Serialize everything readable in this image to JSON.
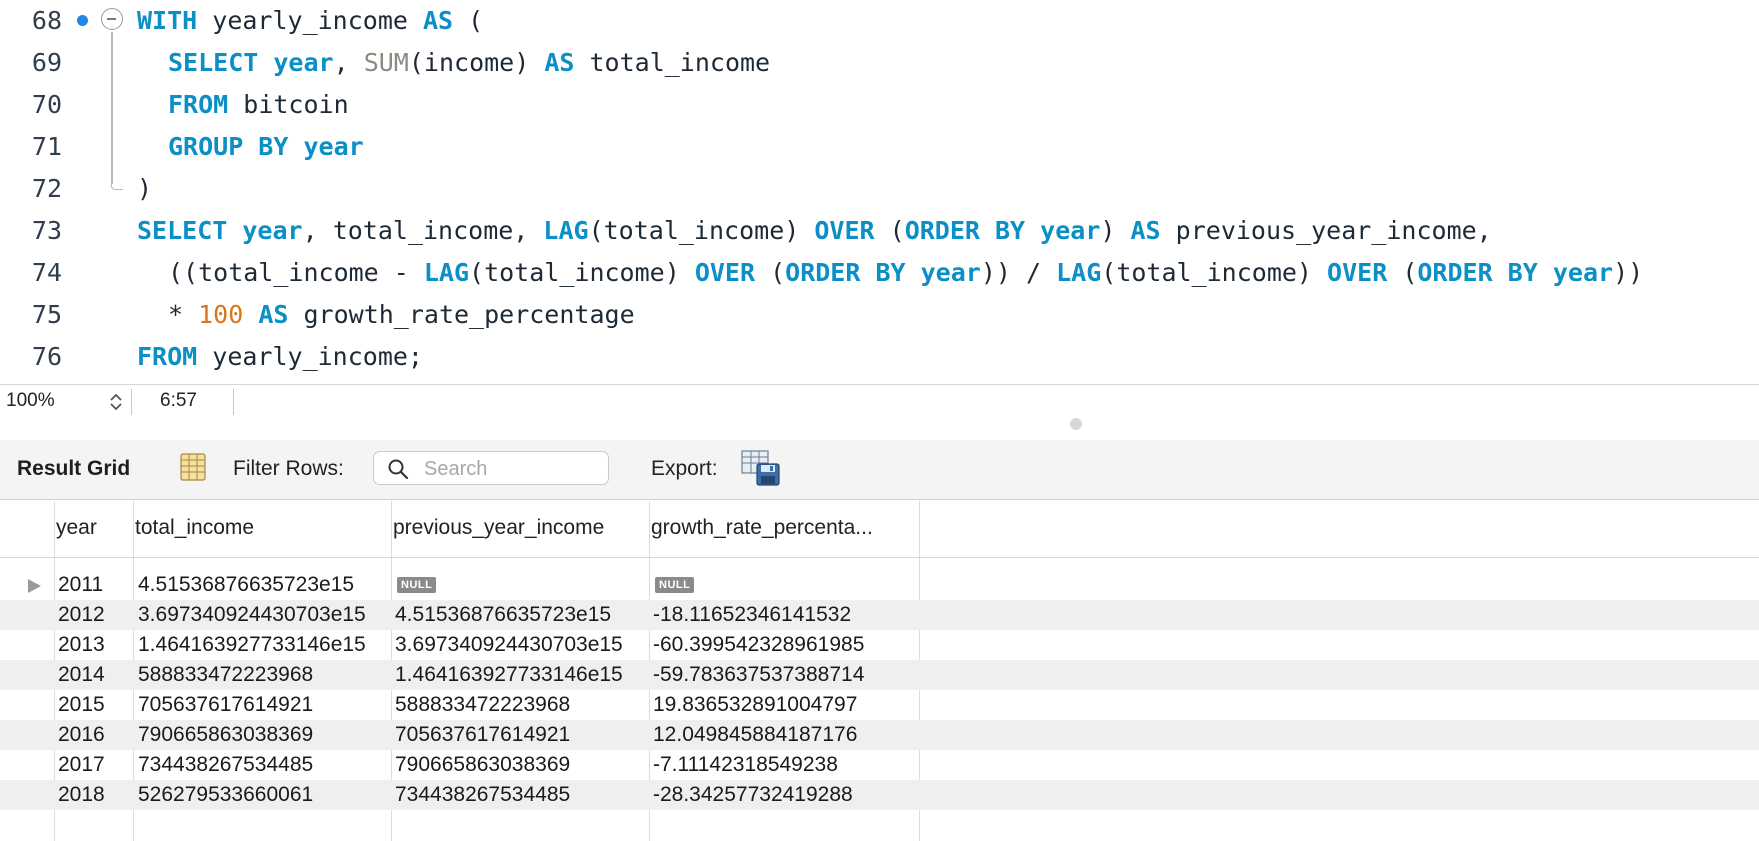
{
  "editor": {
    "lines": [
      {
        "num": "68",
        "tokens": [
          {
            "t": "WITH",
            "k": "kw"
          },
          {
            "t": " yearly_income ",
            "k": ""
          },
          {
            "t": "AS",
            "k": "kw"
          },
          {
            "t": " (",
            "k": ""
          }
        ]
      },
      {
        "num": "69",
        "tokens": [
          {
            "t": "SELECT",
            "k": "kw"
          },
          {
            "t": " ",
            "k": ""
          },
          {
            "t": "year",
            "k": "kw"
          },
          {
            "t": ", ",
            "k": ""
          },
          {
            "t": "SUM",
            "k": "fn"
          },
          {
            "t": "(income) ",
            "k": ""
          },
          {
            "t": "AS",
            "k": "kw"
          },
          {
            "t": " total_income",
            "k": ""
          }
        ]
      },
      {
        "num": "70",
        "tokens": [
          {
            "t": "FROM",
            "k": "kw"
          },
          {
            "t": " bitcoin",
            "k": ""
          }
        ]
      },
      {
        "num": "71",
        "tokens": [
          {
            "t": "GROUP BY",
            "k": "kw"
          },
          {
            "t": " ",
            "k": ""
          },
          {
            "t": "year",
            "k": "kw"
          }
        ]
      },
      {
        "num": "72",
        "tokens": [
          {
            "t": ")",
            "k": ""
          }
        ]
      },
      {
        "num": "73",
        "tokens": [
          {
            "t": "SELECT",
            "k": "kw"
          },
          {
            "t": " ",
            "k": ""
          },
          {
            "t": "year",
            "k": "kw"
          },
          {
            "t": ", total_income, ",
            "k": ""
          },
          {
            "t": "LAG",
            "k": "kw"
          },
          {
            "t": "(total_income) ",
            "k": ""
          },
          {
            "t": "OVER",
            "k": "kw"
          },
          {
            "t": " (",
            "k": ""
          },
          {
            "t": "ORDER BY",
            "k": "kw"
          },
          {
            "t": " ",
            "k": ""
          },
          {
            "t": "year",
            "k": "kw"
          },
          {
            "t": ") ",
            "k": ""
          },
          {
            "t": "AS",
            "k": "kw"
          },
          {
            "t": " previous_year_income,",
            "k": ""
          }
        ]
      },
      {
        "num": "74",
        "tokens": [
          {
            "t": "((total_income - ",
            "k": ""
          },
          {
            "t": "LAG",
            "k": "kw"
          },
          {
            "t": "(total_income) ",
            "k": ""
          },
          {
            "t": "OVER",
            "k": "kw"
          },
          {
            "t": " (",
            "k": ""
          },
          {
            "t": "ORDER BY",
            "k": "kw"
          },
          {
            "t": " ",
            "k": ""
          },
          {
            "t": "year",
            "k": "kw"
          },
          {
            "t": ")) / ",
            "k": ""
          },
          {
            "t": "LAG",
            "k": "kw"
          },
          {
            "t": "(total_income) ",
            "k": ""
          },
          {
            "t": "OVER",
            "k": "kw"
          },
          {
            "t": " (",
            "k": ""
          },
          {
            "t": "ORDER BY",
            "k": "kw"
          },
          {
            "t": " ",
            "k": ""
          },
          {
            "t": "year",
            "k": "kw"
          },
          {
            "t": "))",
            "k": ""
          }
        ]
      },
      {
        "num": "75",
        "tokens": [
          {
            "t": "* ",
            "k": ""
          },
          {
            "t": "100",
            "k": "num"
          },
          {
            "t": " ",
            "k": ""
          },
          {
            "t": "AS",
            "k": "kw"
          },
          {
            "t": " growth_rate_percentage",
            "k": ""
          }
        ]
      },
      {
        "num": "76",
        "tokens": [
          {
            "t": "FROM",
            "k": "kw"
          },
          {
            "t": " yearly_income;",
            "k": ""
          }
        ]
      }
    ]
  },
  "statusbar": {
    "zoom": "100%",
    "cursor_position": "6:57"
  },
  "result_toolbar": {
    "title": "Result Grid",
    "filter_label": "Filter Rows:",
    "search_placeholder": "Search",
    "search_value": "",
    "export_label": "Export:"
  },
  "grid": {
    "columns": [
      "year",
      "total_income",
      "previous_year_income",
      "growth_rate_percenta..."
    ],
    "null_label": "NULL",
    "rows": [
      [
        "2011",
        "4.51536876635723e15",
        null,
        null
      ],
      [
        "2012",
        "3.697340924430703e15",
        "4.51536876635723e15",
        "-18.11652346141532"
      ],
      [
        "2013",
        "1.464163927733146e15",
        "3.697340924430703e15",
        "-60.399542328961985"
      ],
      [
        "2014",
        "588833472223968",
        "1.464163927733146e15",
        "-59.783637537388714"
      ],
      [
        "2015",
        "705637617614921",
        "588833472223968",
        "19.836532891004797"
      ],
      [
        "2016",
        "790665863038369",
        "705637617614921",
        "12.049845884187176"
      ],
      [
        "2017",
        "734438267534485",
        "790665863038369",
        "-7.11142318549238"
      ],
      [
        "2018",
        "526279533660061",
        "734438267534485",
        "-28.34257732419288"
      ]
    ]
  },
  "colors": {
    "keyword": "#0a8fc7",
    "function": "#8a8a80",
    "number": "#d9761a",
    "breakpoint": "#1e88e5"
  }
}
